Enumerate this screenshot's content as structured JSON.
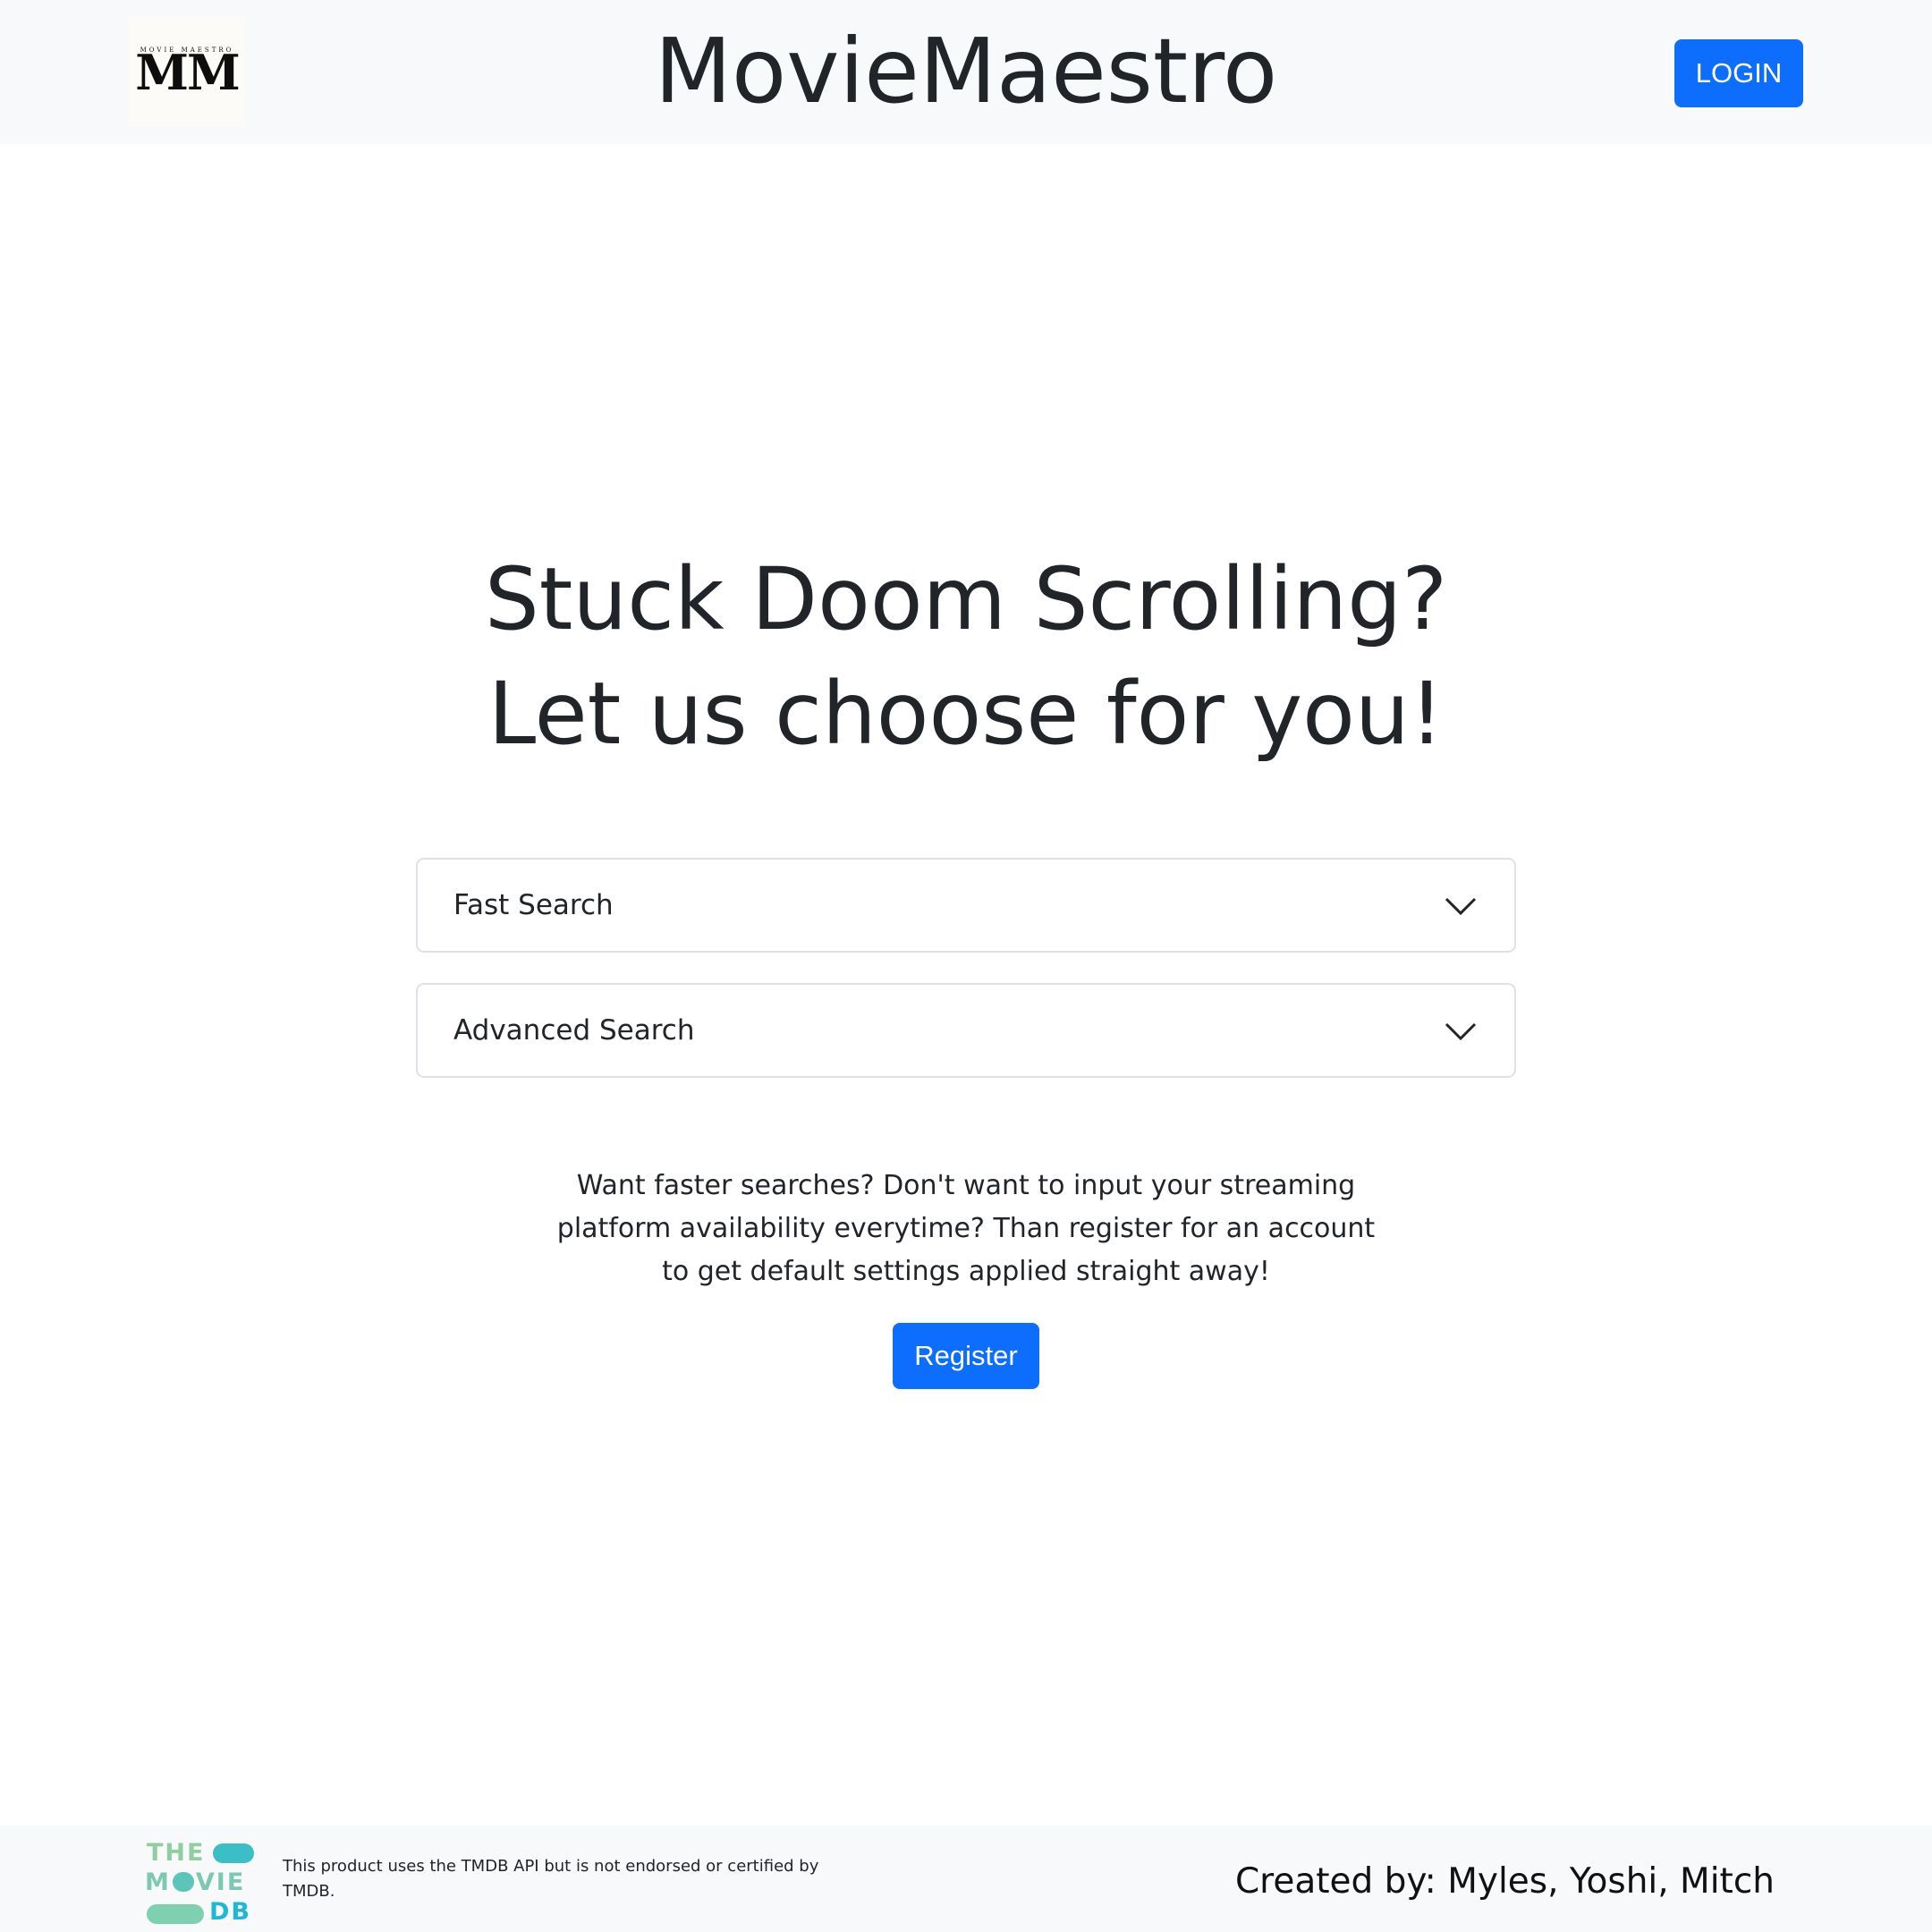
{
  "header": {
    "logo_small_text": "MOVIE MAESTRO",
    "logo_letters": "MM",
    "title": "MovieMaestro",
    "login_label": "LOGIN"
  },
  "hero": {
    "line1": "Stuck Doom Scrolling?",
    "line2": "Let us choose for you!"
  },
  "accordion": [
    {
      "label": "Fast Search",
      "icon": "chevron-down-icon",
      "expanded": false
    },
    {
      "label": "Advanced Search",
      "icon": "chevron-down-icon",
      "expanded": false
    }
  ],
  "cta": {
    "text": "Want faster searches? Don't want to input your streaming platform availability everytime? Than register for an account to get default settings applied straight away!",
    "register_label": "Register"
  },
  "footer": {
    "tmdb_logo": {
      "line1": "THE",
      "line2a": "M",
      "line2b": "VIE",
      "line3": "DB"
    },
    "disclaimer": "This product uses the TMDB API but is not endorsed or certified by TMDB.",
    "credits": "Created by: Myles, Yoshi, Mitch"
  },
  "colors": {
    "primary": "#0d6efd",
    "header_bg": "#f8f9fa",
    "text": "#212529",
    "border": "#dee2e6",
    "tmdb_green": "#90cea1",
    "tmdb_blue": "#01b4e4"
  }
}
